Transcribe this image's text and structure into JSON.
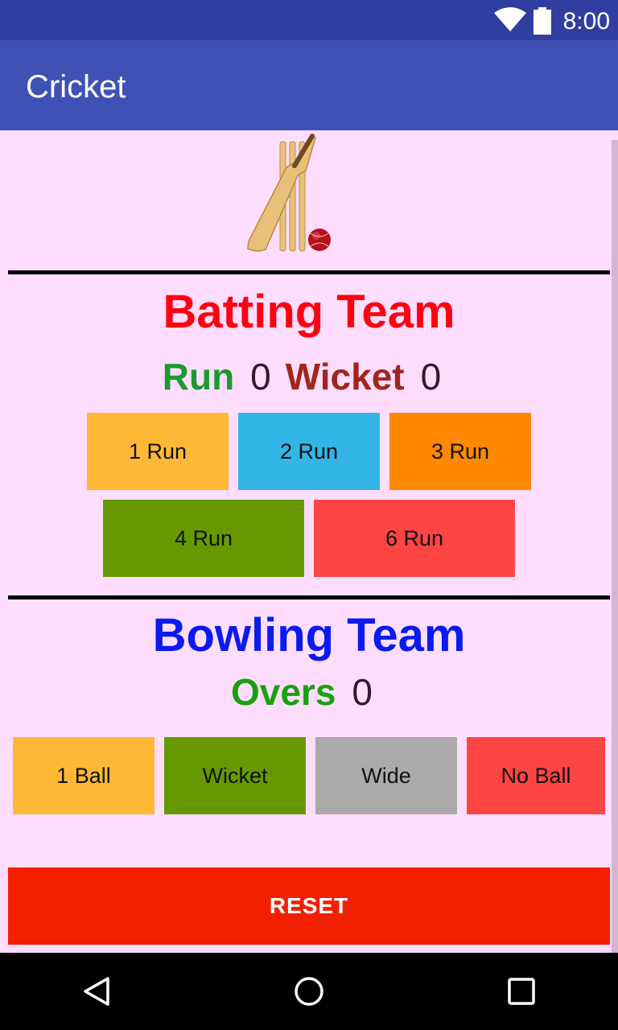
{
  "status_bar": {
    "time": "8:00",
    "icons": [
      "wifi-icon",
      "battery-icon"
    ]
  },
  "app_bar": {
    "title": "Cricket"
  },
  "logo": {
    "icon": "cricket-bat-ball-icon"
  },
  "batting": {
    "heading": "Batting Team",
    "run_label": "Run",
    "run_value": "0",
    "wicket_label": "Wicket",
    "wicket_value": "0",
    "buttons": {
      "one": "1 Run",
      "two": "2 Run",
      "three": "3 Run",
      "four": "4 Run",
      "six": "6 Run"
    }
  },
  "bowling": {
    "heading": "Bowling Team",
    "overs_label": "Overs",
    "overs_value": "0",
    "buttons": {
      "ball": "1 Ball",
      "wicket": "Wicket",
      "wide": "Wide",
      "no_ball": "No Ball"
    }
  },
  "reset_label": "RESET",
  "nav": {
    "icons": [
      "back-icon",
      "home-icon",
      "recents-icon"
    ]
  },
  "colors": {
    "primary": "#3F51B5",
    "primary_dark": "#303F9F",
    "background": "#FFDDFF",
    "batting_heading": "#FF0011",
    "bowling_heading": "#0A1AF0",
    "run_label": "#1A9A2F",
    "wicket_label": "#A0261B",
    "overs_label": "#1AA00F",
    "reset": "#F21F00"
  }
}
